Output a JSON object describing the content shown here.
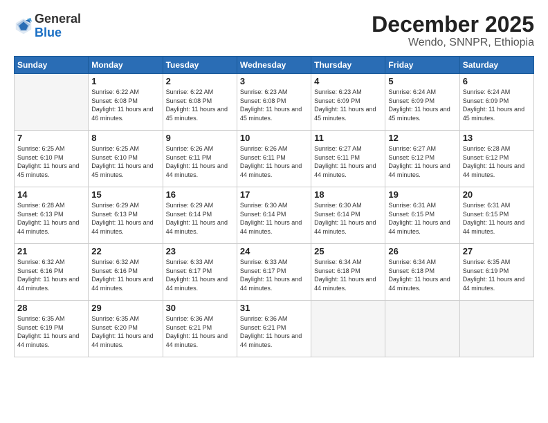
{
  "logo": {
    "general": "General",
    "blue": "Blue"
  },
  "title": "December 2025",
  "subtitle": "Wendo, SNNPR, Ethiopia",
  "weekdays": [
    "Sunday",
    "Monday",
    "Tuesday",
    "Wednesday",
    "Thursday",
    "Friday",
    "Saturday"
  ],
  "weeks": [
    [
      {
        "day": "",
        "sunrise": "",
        "sunset": "",
        "daylight": ""
      },
      {
        "day": "1",
        "sunrise": "Sunrise: 6:22 AM",
        "sunset": "Sunset: 6:08 PM",
        "daylight": "Daylight: 11 hours and 46 minutes."
      },
      {
        "day": "2",
        "sunrise": "Sunrise: 6:22 AM",
        "sunset": "Sunset: 6:08 PM",
        "daylight": "Daylight: 11 hours and 45 minutes."
      },
      {
        "day": "3",
        "sunrise": "Sunrise: 6:23 AM",
        "sunset": "Sunset: 6:08 PM",
        "daylight": "Daylight: 11 hours and 45 minutes."
      },
      {
        "day": "4",
        "sunrise": "Sunrise: 6:23 AM",
        "sunset": "Sunset: 6:09 PM",
        "daylight": "Daylight: 11 hours and 45 minutes."
      },
      {
        "day": "5",
        "sunrise": "Sunrise: 6:24 AM",
        "sunset": "Sunset: 6:09 PM",
        "daylight": "Daylight: 11 hours and 45 minutes."
      },
      {
        "day": "6",
        "sunrise": "Sunrise: 6:24 AM",
        "sunset": "Sunset: 6:09 PM",
        "daylight": "Daylight: 11 hours and 45 minutes."
      }
    ],
    [
      {
        "day": "7",
        "sunrise": "Sunrise: 6:25 AM",
        "sunset": "Sunset: 6:10 PM",
        "daylight": "Daylight: 11 hours and 45 minutes."
      },
      {
        "day": "8",
        "sunrise": "Sunrise: 6:25 AM",
        "sunset": "Sunset: 6:10 PM",
        "daylight": "Daylight: 11 hours and 45 minutes."
      },
      {
        "day": "9",
        "sunrise": "Sunrise: 6:26 AM",
        "sunset": "Sunset: 6:11 PM",
        "daylight": "Daylight: 11 hours and 44 minutes."
      },
      {
        "day": "10",
        "sunrise": "Sunrise: 6:26 AM",
        "sunset": "Sunset: 6:11 PM",
        "daylight": "Daylight: 11 hours and 44 minutes."
      },
      {
        "day": "11",
        "sunrise": "Sunrise: 6:27 AM",
        "sunset": "Sunset: 6:11 PM",
        "daylight": "Daylight: 11 hours and 44 minutes."
      },
      {
        "day": "12",
        "sunrise": "Sunrise: 6:27 AM",
        "sunset": "Sunset: 6:12 PM",
        "daylight": "Daylight: 11 hours and 44 minutes."
      },
      {
        "day": "13",
        "sunrise": "Sunrise: 6:28 AM",
        "sunset": "Sunset: 6:12 PM",
        "daylight": "Daylight: 11 hours and 44 minutes."
      }
    ],
    [
      {
        "day": "14",
        "sunrise": "Sunrise: 6:28 AM",
        "sunset": "Sunset: 6:13 PM",
        "daylight": "Daylight: 11 hours and 44 minutes."
      },
      {
        "day": "15",
        "sunrise": "Sunrise: 6:29 AM",
        "sunset": "Sunset: 6:13 PM",
        "daylight": "Daylight: 11 hours and 44 minutes."
      },
      {
        "day": "16",
        "sunrise": "Sunrise: 6:29 AM",
        "sunset": "Sunset: 6:14 PM",
        "daylight": "Daylight: 11 hours and 44 minutes."
      },
      {
        "day": "17",
        "sunrise": "Sunrise: 6:30 AM",
        "sunset": "Sunset: 6:14 PM",
        "daylight": "Daylight: 11 hours and 44 minutes."
      },
      {
        "day": "18",
        "sunrise": "Sunrise: 6:30 AM",
        "sunset": "Sunset: 6:14 PM",
        "daylight": "Daylight: 11 hours and 44 minutes."
      },
      {
        "day": "19",
        "sunrise": "Sunrise: 6:31 AM",
        "sunset": "Sunset: 6:15 PM",
        "daylight": "Daylight: 11 hours and 44 minutes."
      },
      {
        "day": "20",
        "sunrise": "Sunrise: 6:31 AM",
        "sunset": "Sunset: 6:15 PM",
        "daylight": "Daylight: 11 hours and 44 minutes."
      }
    ],
    [
      {
        "day": "21",
        "sunrise": "Sunrise: 6:32 AM",
        "sunset": "Sunset: 6:16 PM",
        "daylight": "Daylight: 11 hours and 44 minutes."
      },
      {
        "day": "22",
        "sunrise": "Sunrise: 6:32 AM",
        "sunset": "Sunset: 6:16 PM",
        "daylight": "Daylight: 11 hours and 44 minutes."
      },
      {
        "day": "23",
        "sunrise": "Sunrise: 6:33 AM",
        "sunset": "Sunset: 6:17 PM",
        "daylight": "Daylight: 11 hours and 44 minutes."
      },
      {
        "day": "24",
        "sunrise": "Sunrise: 6:33 AM",
        "sunset": "Sunset: 6:17 PM",
        "daylight": "Daylight: 11 hours and 44 minutes."
      },
      {
        "day": "25",
        "sunrise": "Sunrise: 6:34 AM",
        "sunset": "Sunset: 6:18 PM",
        "daylight": "Daylight: 11 hours and 44 minutes."
      },
      {
        "day": "26",
        "sunrise": "Sunrise: 6:34 AM",
        "sunset": "Sunset: 6:18 PM",
        "daylight": "Daylight: 11 hours and 44 minutes."
      },
      {
        "day": "27",
        "sunrise": "Sunrise: 6:35 AM",
        "sunset": "Sunset: 6:19 PM",
        "daylight": "Daylight: 11 hours and 44 minutes."
      }
    ],
    [
      {
        "day": "28",
        "sunrise": "Sunrise: 6:35 AM",
        "sunset": "Sunset: 6:19 PM",
        "daylight": "Daylight: 11 hours and 44 minutes."
      },
      {
        "day": "29",
        "sunrise": "Sunrise: 6:35 AM",
        "sunset": "Sunset: 6:20 PM",
        "daylight": "Daylight: 11 hours and 44 minutes."
      },
      {
        "day": "30",
        "sunrise": "Sunrise: 6:36 AM",
        "sunset": "Sunset: 6:21 PM",
        "daylight": "Daylight: 11 hours and 44 minutes."
      },
      {
        "day": "31",
        "sunrise": "Sunrise: 6:36 AM",
        "sunset": "Sunset: 6:21 PM",
        "daylight": "Daylight: 11 hours and 44 minutes."
      },
      {
        "day": "",
        "sunrise": "",
        "sunset": "",
        "daylight": ""
      },
      {
        "day": "",
        "sunrise": "",
        "sunset": "",
        "daylight": ""
      },
      {
        "day": "",
        "sunrise": "",
        "sunset": "",
        "daylight": ""
      }
    ]
  ]
}
